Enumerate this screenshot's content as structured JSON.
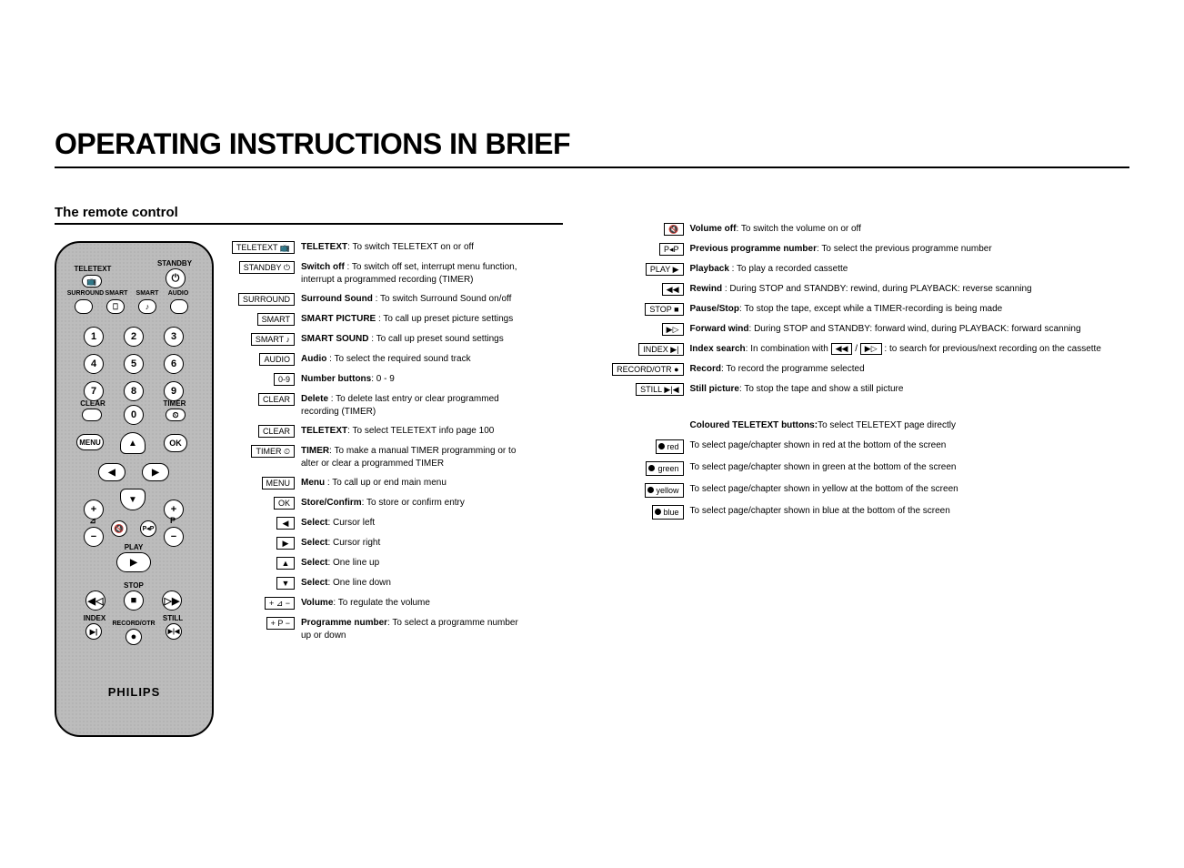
{
  "title": "OPERATING INSTRUCTIONS IN BRIEF",
  "subtitle": "The remote control",
  "remote": {
    "labels": {
      "teletext": "TELETEXT",
      "standby": "STANDBY",
      "surround": "SURROUND",
      "smart1": "SMART",
      "smart2": "SMART",
      "audio": "AUDIO",
      "clear": "CLEAR",
      "timer": "TIMER",
      "menu": "MENU",
      "ok": "OK",
      "play": "PLAY",
      "stop": "STOP",
      "index": "INDEX",
      "recordotr": "RECORD/OTR",
      "still": "STILL",
      "p": "P"
    },
    "brand": "PHILIPS",
    "digits": [
      "1",
      "2",
      "3",
      "4",
      "5",
      "6",
      "7",
      "8",
      "9",
      "0"
    ]
  },
  "left_items": [
    {
      "key": "TELETEXT 📺",
      "bold": "TELETEXT",
      "text": ": To switch TELETEXT on or off"
    },
    {
      "key": "STANDBY ⏻",
      "bold": "Switch off",
      "text": " : To switch off set, interrupt menu function, interrupt a programmed recording (TIMER)"
    },
    {
      "key": "SURROUND",
      "bold": "Surround Sound",
      "text": " : To switch Surround Sound on/off"
    },
    {
      "key": "SMART",
      "bold": "SMART PICTURE",
      "text": " : To call up preset picture settings"
    },
    {
      "key": "SMART ♪",
      "bold": "SMART SOUND",
      "text": " : To call up preset sound settings"
    },
    {
      "key": "AUDIO",
      "bold": "Audio",
      "text": " : To select the required sound track"
    },
    {
      "key": "0-9",
      "bold": "Number buttons",
      "text": ": 0 - 9"
    },
    {
      "key": "CLEAR",
      "bold": "Delete",
      "text": " : To delete last entry or clear programmed recording (TIMER)"
    },
    {
      "key": "CLEAR",
      "bold": "TELETEXT",
      "text": ": To select TELETEXT info page 100"
    },
    {
      "key": "TIMER ⏲",
      "bold": "TIMER",
      "text": ": To make a manual TIMER programming or to alter or clear a programmed TIMER"
    },
    {
      "key": "MENU",
      "bold": "Menu",
      "text": " : To call up or end main menu"
    },
    {
      "key": "OK",
      "bold": "Store/Confirm",
      "text": ": To store or confirm entry"
    },
    {
      "key": "◀",
      "bold": "Select",
      "text": ": Cursor left"
    },
    {
      "key": "▶",
      "bold": "Select",
      "text": ": Cursor right"
    },
    {
      "key": "▲",
      "bold": "Select",
      "text": ": One line up"
    },
    {
      "key": "▼",
      "bold": "Select",
      "text": ": One line down"
    },
    {
      "key": "+ ⊿ −",
      "bold": "Volume",
      "text": ": To regulate the volume"
    },
    {
      "key": "+ P −",
      "bold": "Programme number",
      "text": ": To select a programme number up or down"
    }
  ],
  "right_items": [
    {
      "key": "🔇",
      "bold": "Volume off",
      "text": ": To switch the volume on or off"
    },
    {
      "key": "P◂P",
      "bold": "Previous programme number",
      "text": ": To select the previous programme number"
    },
    {
      "key": "PLAY ▶",
      "bold": "Playback",
      "text": " : To play a recorded cassette"
    },
    {
      "key": "◀◀",
      "bold": "Rewind",
      "text": " : During STOP and STANDBY: rewind, during PLAYBACK: reverse scanning"
    },
    {
      "key": "STOP ■",
      "bold": "Pause/Stop",
      "text": ": To stop the tape, except while a TIMER-recording is being made"
    },
    {
      "key": "▶▷",
      "bold": "Forward wind",
      "text": ": During STOP and STANDBY: forward wind, during PLAYBACK: forward scanning"
    },
    {
      "key": "INDEX ▶|",
      "bold": "Index search",
      "text_pre": ": In combination with ",
      "inline1": "◀◀",
      "mid": " / ",
      "inline2": "▶▷",
      "text_post": " : to search for previous/next recording on the cassette",
      "has_inline": true
    },
    {
      "key": "RECORD/OTR ●",
      "bold": "Record",
      "text": ": To record the programme selected"
    },
    {
      "key": "STILL ▶|◀",
      "bold": "Still picture",
      "text": ": To stop the tape and show a still picture"
    }
  ],
  "teletext_header": {
    "bold": "Coloured TELETEXT buttons:",
    "text": "To select TELETEXT page directly"
  },
  "color_items": [
    {
      "color": "red",
      "label": "red",
      "text": "To select page/chapter shown in red at the bottom of the screen"
    },
    {
      "color": "green",
      "label": "green",
      "text": "To select page/chapter shown in green at the bottom of the screen"
    },
    {
      "color": "yellow",
      "label": "yellow",
      "text": "To select page/chapter shown in yellow at the bottom of the screen"
    },
    {
      "color": "blue",
      "label": "blue",
      "text": "To select page/chapter shown in blue at the bottom of the screen"
    }
  ]
}
